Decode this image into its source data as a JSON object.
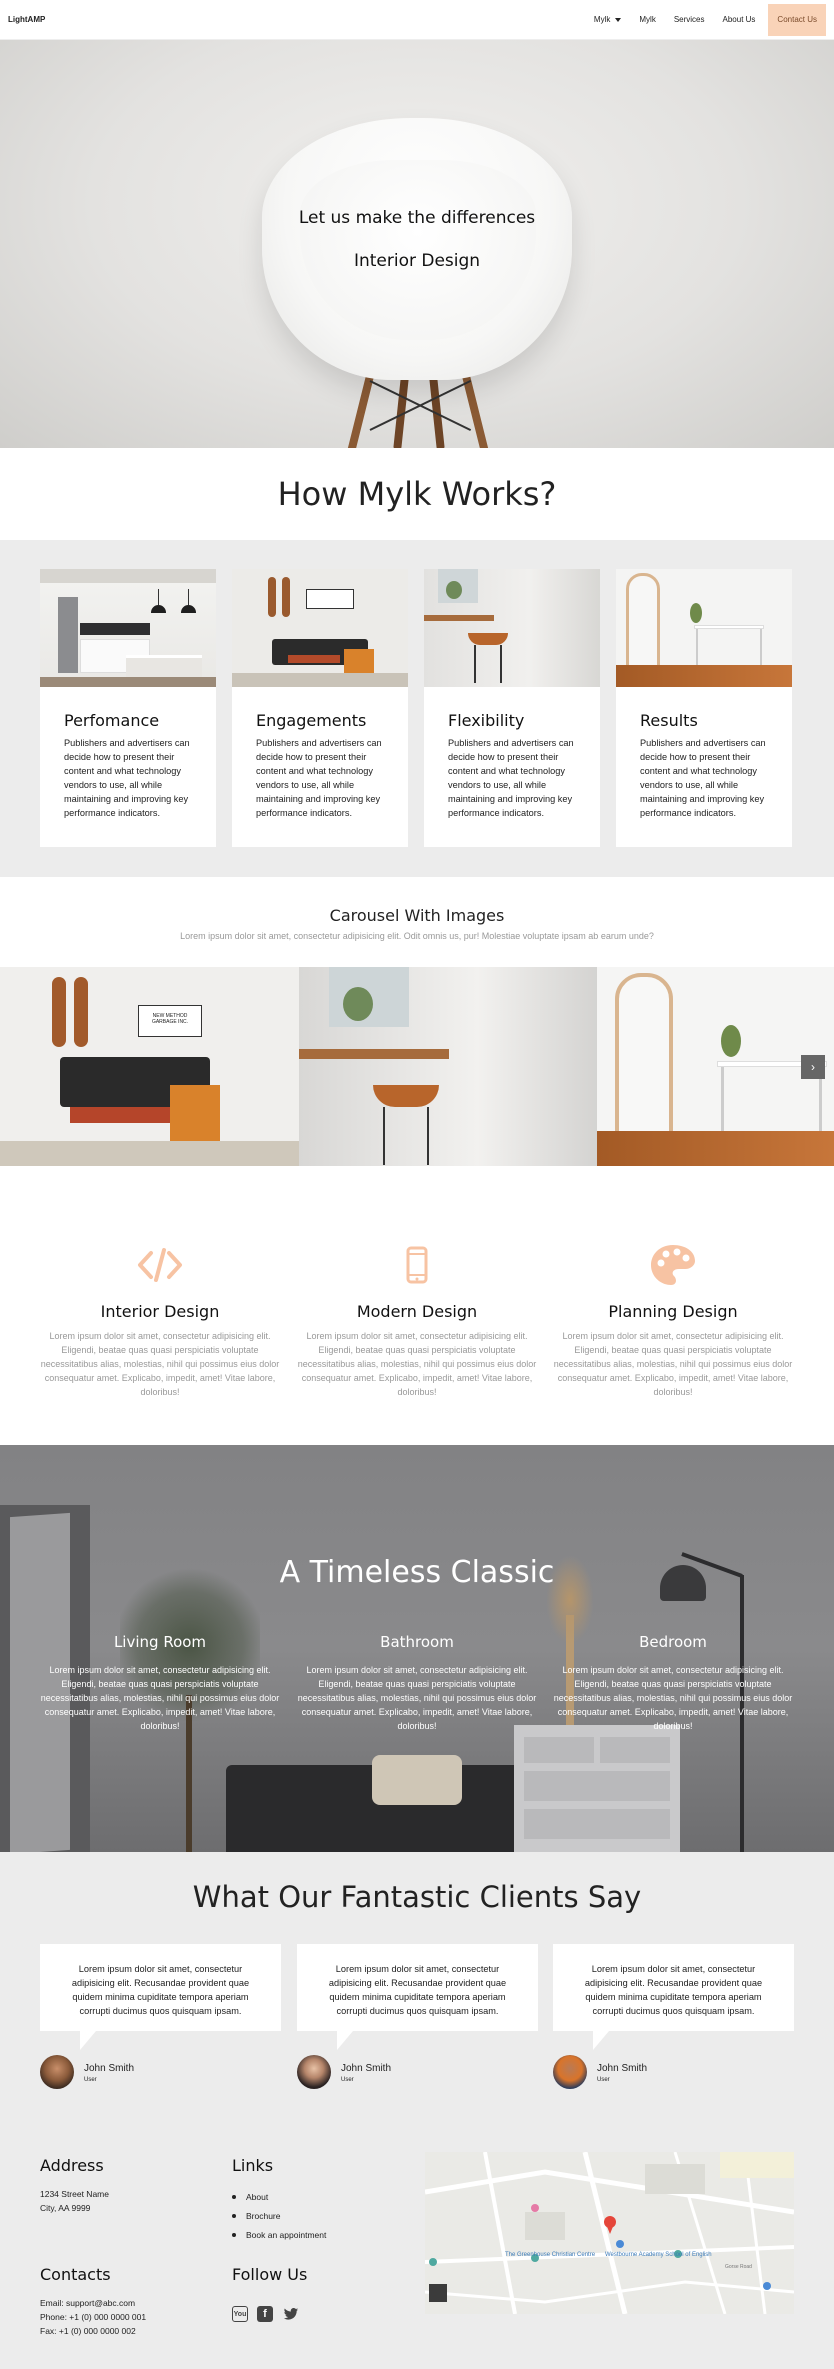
{
  "nav": {
    "brand": "LightAMP",
    "links": [
      "Mylk",
      "Mylk",
      "Services",
      "About Us"
    ],
    "contact": "Contact Us"
  },
  "hero": {
    "line1": "Let us make the differences",
    "line2": "Interior Design"
  },
  "how": {
    "title": "How Mylk Works?",
    "cards": [
      {
        "title": "Perfomance",
        "text": "Publishers and advertisers can decide how to present their content and what technology vendors to use, all while maintaining and improving key performance indicators."
      },
      {
        "title": "Engagements",
        "text": "Publishers and advertisers can decide how to present their content and what technology vendors to use, all while maintaining and improving key performance indicators."
      },
      {
        "title": "Flexibility",
        "text": "Publishers and advertisers can decide how to present their content and what technology vendors to use, all while maintaining and improving key performance indicators."
      },
      {
        "title": "Results",
        "text": "Publishers and advertisers can decide how to present their content and what technology vendors to use, all while maintaining and improving key performance indicators."
      }
    ]
  },
  "carousel": {
    "title": "Carousel With Images",
    "subtitle": "Lorem ipsum dolor sit amet, consectetur adipisicing elit. Odit omnis us, pur! Molestiae voluptate ipsam ab earum unde?",
    "sign_line1": "NEW METHOD",
    "sign_line2": "GARBAGE INC.",
    "next_icon": "chevron-right-icon",
    "next_glyph": "›"
  },
  "features": [
    {
      "icon": "code-icon",
      "title": "Interior Design",
      "text": "Lorem ipsum dolor sit amet, consectetur adipisicing elit. Eligendi, beatae quas quasi perspiciatis voluptate necessitatibus alias, molestias, nihil qui possimus eius dolor consequatur amet. Explicabo, impedit, amet! Vitae labore, doloribus!"
    },
    {
      "icon": "phone-icon",
      "title": "Modern Design",
      "text": "Lorem ipsum dolor sit amet, consectetur adipisicing elit. Eligendi, beatae quas quasi perspiciatis voluptate necessitatibus alias, molestias, nihil qui possimus eius dolor consequatur amet. Explicabo, impedit, amet! Vitae labore, doloribus!"
    },
    {
      "icon": "palette-icon",
      "title": "Planning Design",
      "text": "Lorem ipsum dolor sit amet, consectetur adipisicing elit. Eligendi, beatae quas quasi perspiciatis voluptate necessitatibus alias, molestias, nihil qui possimus eius dolor consequatur amet. Explicabo, impedit, amet! Vitae labore, doloribus!"
    }
  ],
  "timeless": {
    "title": "A Timeless Classic",
    "cols": [
      {
        "title": "Living Room",
        "text": "Lorem ipsum dolor sit amet, consectetur adipisicing elit. Eligendi, beatae quas quasi perspiciatis voluptate necessitatibus alias, molestias, nihil qui possimus eius dolor consequatur amet. Explicabo, impedit, amet! Vitae labore, doloribus!"
      },
      {
        "title": "Bathroom",
        "text": "Lorem ipsum dolor sit amet, consectetur adipisicing elit. Eligendi, beatae quas quasi perspiciatis voluptate necessitatibus alias, molestias, nihil qui possimus eius dolor consequatur amet. Explicabo, impedit, amet! Vitae labore, doloribus!"
      },
      {
        "title": "Bedroom",
        "text": "Lorem ipsum dolor sit amet, consectetur adipisicing elit. Eligendi, beatae quas quasi perspiciatis voluptate necessitatibus alias, molestias, nihil qui possimus eius dolor consequatur amet. Explicabo, impedit, amet! Vitae labore, doloribus!"
      }
    ]
  },
  "testimonials": {
    "title": "What Our Fantastic Clients Say",
    "items": [
      {
        "quote": "Lorem ipsum dolor sit amet, consectetur adipisicing elit. Recusandae provident quae quidem minima cupiditate tempora aperiam corrupti ducimus quos quisquam ipsam.",
        "name": "John Smith",
        "role": "User"
      },
      {
        "quote": "Lorem ipsum dolor sit amet, consectetur adipisicing elit. Recusandae provident quae quidem minima cupiditate tempora aperiam corrupti ducimus quos quisquam ipsam.",
        "name": "John Smith",
        "role": "User"
      },
      {
        "quote": "Lorem ipsum dolor sit amet, consectetur adipisicing elit. Recusandae provident quae quidem minima cupiditate tempora aperiam corrupti ducimus quos quisquam ipsam.",
        "name": "John Smith",
        "role": "User"
      }
    ]
  },
  "footer": {
    "address_title": "Address",
    "address_line1": "1234 Street Name",
    "address_line2": "City, AA 9999",
    "contacts_title": "Contacts",
    "email": "Email: support@abc.com",
    "phone": "Phone: +1 (0) 000 0000 001",
    "fax": "Fax: +1 (0) 000 0000 002",
    "links_title": "Links",
    "links": [
      "About",
      "Brochure",
      "Book an appointment"
    ],
    "follow_title": "Follow Us",
    "social": [
      "youtube-icon",
      "facebook-icon",
      "twitter-icon"
    ],
    "youtube_glyph": "You",
    "facebook_glyph": "f",
    "map_places": [
      "The Greenhouse Christian Centre",
      "Westbourne Academy School of English",
      "Gorse Road"
    ]
  },
  "colors": {
    "accent": "#f9d3b8",
    "accent_text": "#7a4a2a",
    "icon_peach": "#f7c3a3",
    "section_gray": "#ececec"
  }
}
